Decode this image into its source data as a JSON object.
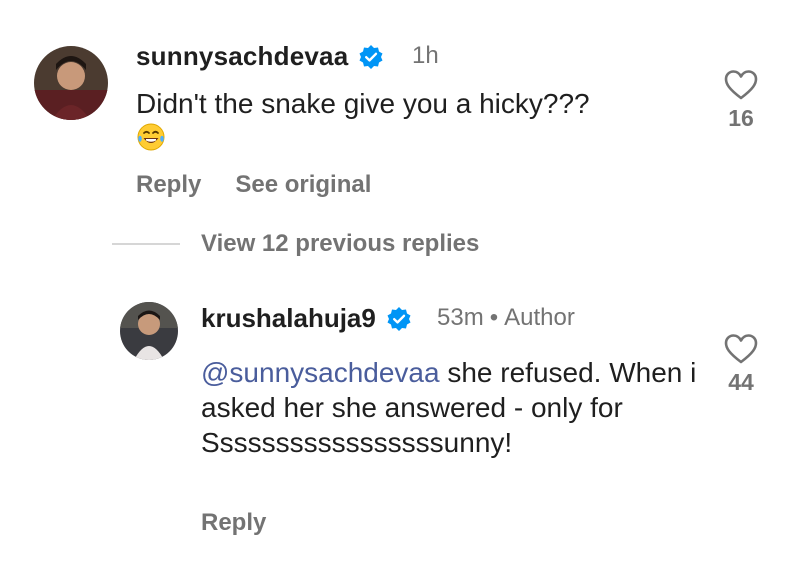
{
  "comments": [
    {
      "username": "sunnysachdevaa",
      "time": "1h",
      "text": "Didn't the snake give you a hicky???",
      "emoji": "face-with-tears-of-joy",
      "likes": "16",
      "actions": {
        "reply": "Reply",
        "see_original": "See original"
      }
    }
  ],
  "view_replies": "View 12 previous replies",
  "reply": {
    "username": "krushalahuja9",
    "time": "53m",
    "separator": "•",
    "badge": "Author",
    "mention": "@sunnysachdevaa",
    "text": " she refused. When i asked her she answered - only for Sssssssssssssssssunny!",
    "likes": "44",
    "reply_label": "Reply"
  },
  "colors": {
    "verified": "#0095f6",
    "mention": "#4a5d9c",
    "muted": "#737373"
  }
}
